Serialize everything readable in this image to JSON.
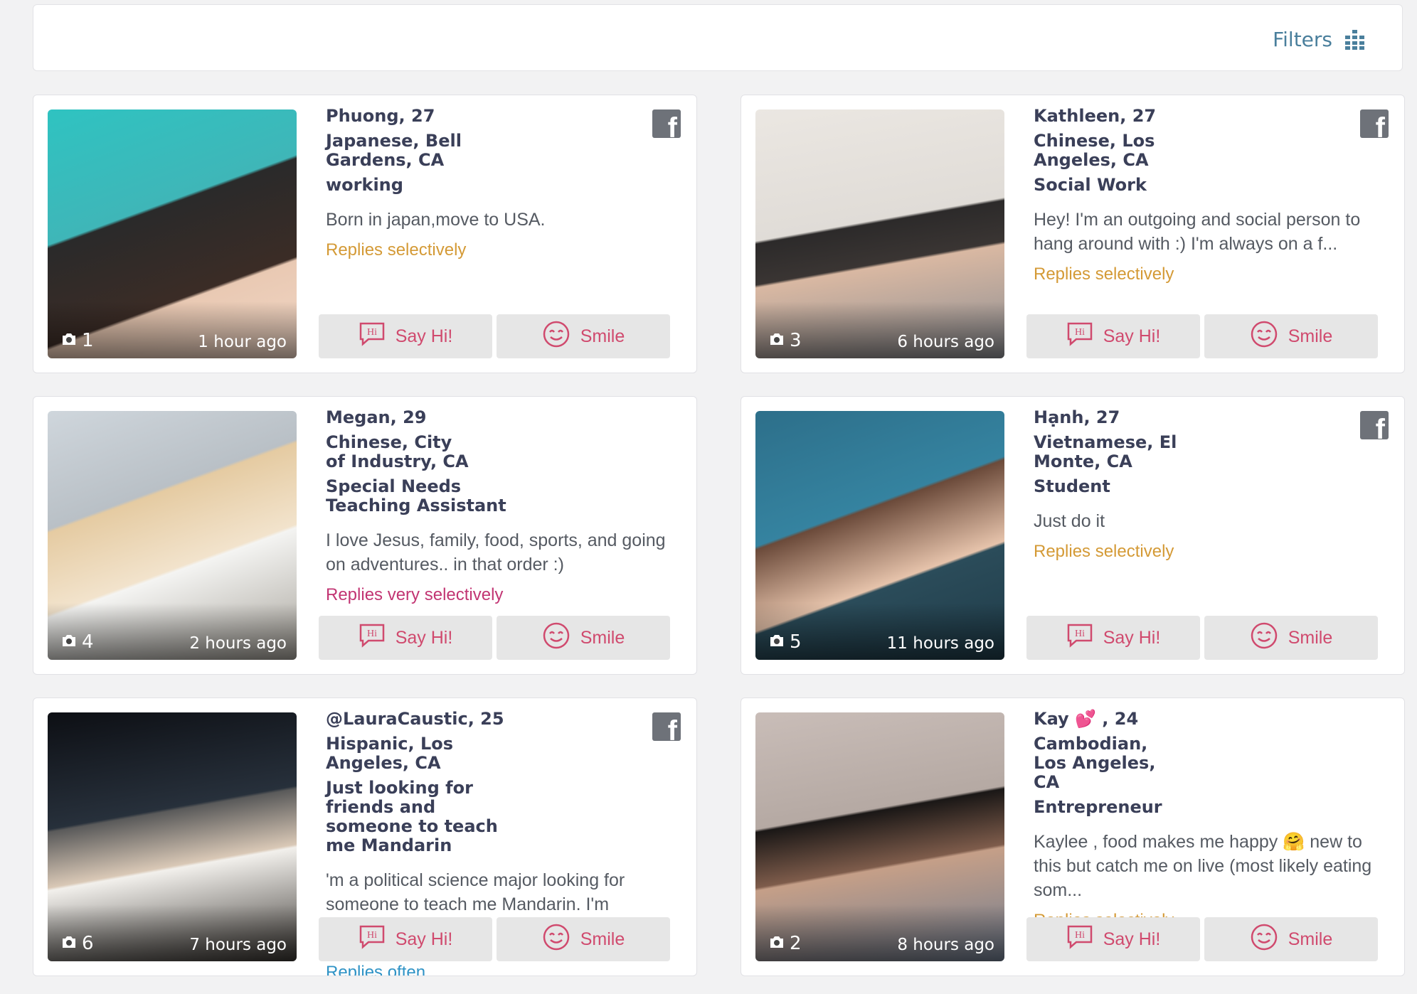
{
  "filters": {
    "label": "Filters",
    "icon": "filter-grid-icon"
  },
  "buttons": {
    "say_hi": "Say Hi!",
    "hi_badge": "Hi",
    "smile": "Smile"
  },
  "colors": {
    "accent": "#d04a6e",
    "selective": "#d49a36",
    "very_selective": "#c23573",
    "filters": "#4a7f9c"
  },
  "cards": [
    {
      "name": "Phuong, 27",
      "location": "Japanese, Bell Gardens, CA",
      "occupation": "working",
      "bio": "Born in japan,move to USA.",
      "replies": "Replies selectively",
      "photo_count": "1",
      "time_ago": "1 hour ago",
      "facebook": true
    },
    {
      "name": "Kathleen, 27",
      "location": "Chinese, Los Angeles, CA",
      "occupation": "Social Work",
      "bio": "Hey! I'm an outgoing and social person to hang around with :) I'm always on a f...",
      "replies": "Replies selectively",
      "photo_count": "3",
      "time_ago": "6 hours ago",
      "facebook": true
    },
    {
      "name": "Megan, 29",
      "location": "Chinese, City of Industry, CA",
      "occupation": "Special Needs Teaching Assistant",
      "bio": "I love Jesus, family, food, sports, and going on adventures.. in that order :)",
      "replies": "Replies very selectively",
      "photo_count": "4",
      "time_ago": "2 hours ago",
      "facebook": false
    },
    {
      "name": "Hạnh, 27",
      "location": "Vietnamese, El Monte, CA",
      "occupation": "Student",
      "bio": "Just do it",
      "replies": "Replies selectively",
      "photo_count": "5",
      "time_ago": "11 hours ago",
      "facebook": true
    },
    {
      "name": "@LauraCaustic, 25",
      "location": "Hispanic, Los Angeles, CA",
      "occupation": "Just looking for friends and someone to teach me Mandarin",
      "bio": "'m a political science major looking for someone to teach me Mandarin. I'm",
      "replies": "Replies often",
      "photo_count": "6",
      "time_ago": "7 hours ago",
      "facebook": true
    },
    {
      "name": "Kay 💕 , 24",
      "location": "Cambodian, Los Angeles, CA",
      "occupation": "Entrepreneur",
      "bio": "Kaylee , food makes me happy 🤗 new to this but catch me on live (most likely eating som...",
      "replies": "Replies selectively",
      "photo_count": "2",
      "time_ago": "8 hours ago",
      "facebook": false
    }
  ]
}
